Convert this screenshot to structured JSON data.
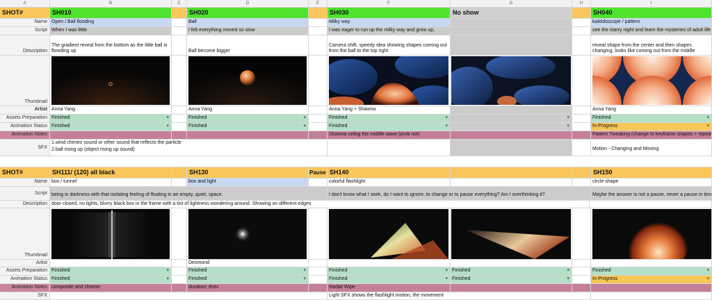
{
  "columns": [
    "A",
    "B",
    "C",
    "D",
    "E",
    "F",
    "G",
    "H",
    "I"
  ],
  "row_labels": {
    "shot": "SHOT#",
    "name": "Name",
    "script": "Script",
    "description": "Description",
    "thumbnail": "Thumbnail",
    "artist": "Artist",
    "assets": "Assets Preparation",
    "animation_status": "Animation Status",
    "animation_notes": "Animation Notes",
    "sfx": "SFX"
  },
  "block1": {
    "shots": {
      "sh010": "SH010",
      "sh020": "SH020",
      "sh030": "SH030",
      "noshow": "No show",
      "sh040": "SH040"
    },
    "names": {
      "sh010": "Open / Ball flooding",
      "sh020": "Ball",
      "sh030": "Milky way",
      "sh040": "kaleidoscope / pattern"
    },
    "scripts": {
      "sh010": "When I was little",
      "sh020": "I felt everything moved so slow",
      "sh030": "I was eager to run up the milky way and grow up,",
      "sh040": "see the starry night and learn the mysteries of adult life"
    },
    "descriptions": {
      "sh010": "The gradient reveal from the bottom as the little ball is flowding up",
      "sh020": "Ball become bigger",
      "sh030": "Camera shift, speedy idea showing shapes coming out from the ball to the top right",
      "sh040": "reveal shape from the center and then shapes changing, looks like coming out from the middle"
    },
    "artists": {
      "sh010": "Anna Yang",
      "sh020": "Anna Yang",
      "sh030": "Anna Yang + Shawna",
      "sh040": "Anna Yang"
    },
    "assets": {
      "sh010": "Finished",
      "sh020": "Finished",
      "sh030": "Finished",
      "sh040": "Finished"
    },
    "status": {
      "sh010": "Finished",
      "sh020": "Finished",
      "sh030": "Finished",
      "sh040": "In-Progress"
    },
    "notes": {
      "sh030": "Shawna celing the middle wave (prob not)",
      "sh040": "Pattern Tweaking (change to keyframe shapes + repeat)"
    },
    "sfx": {
      "line1": "1.wind chimes sound or other sound that reflects the particle",
      "line2": "2.ball rising up (object rising up sound)",
      "sh040": "Motion - Changing and Moving"
    }
  },
  "block2": {
    "shots": {
      "sh111": "SH111/ (120) all black",
      "sh130": "SH130",
      "pause": "Pause",
      "sh140": "SH140",
      "sh150": "SH150"
    },
    "names": {
      "sh111": "box / tunnel",
      "sh130": "box and light",
      "sh140": "colorful flashlight",
      "sh150": "circle shape"
    },
    "scripts": {
      "sh111": "being in darkness with that isolating feeling of floating in an empty, quiet, space.",
      "sh140": "I don't know what I seek, do I want to ignore, to change or to pause everything? Am I overthinking it?",
      "sh150": "Maybe the answer is not a pause, never a pause in time."
    },
    "descriptions": {
      "sh111": "door closed, no lights, blurry black box in the frame with a tint of lightness wondering around. Showing on different edges"
    },
    "artists": {
      "sh130": "Desmond"
    },
    "assets": {
      "sh111": "Finished",
      "sh130": "Finished",
      "sh140": "Finished",
      "sh140b": "Finished",
      "sh150": "Finished"
    },
    "status": {
      "sh111": "Finished",
      "sh130": "Finished",
      "sh140": "Finished",
      "sh140b": "Finished",
      "sh150": "In-Progress"
    },
    "notes": {
      "sh111": "composite and choose",
      "sh130": "duration: 8sec",
      "sh140": "Radial Wipe"
    },
    "sfx": {
      "sh140": "Light SFX shows the flashlight motion, the movement"
    }
  }
}
